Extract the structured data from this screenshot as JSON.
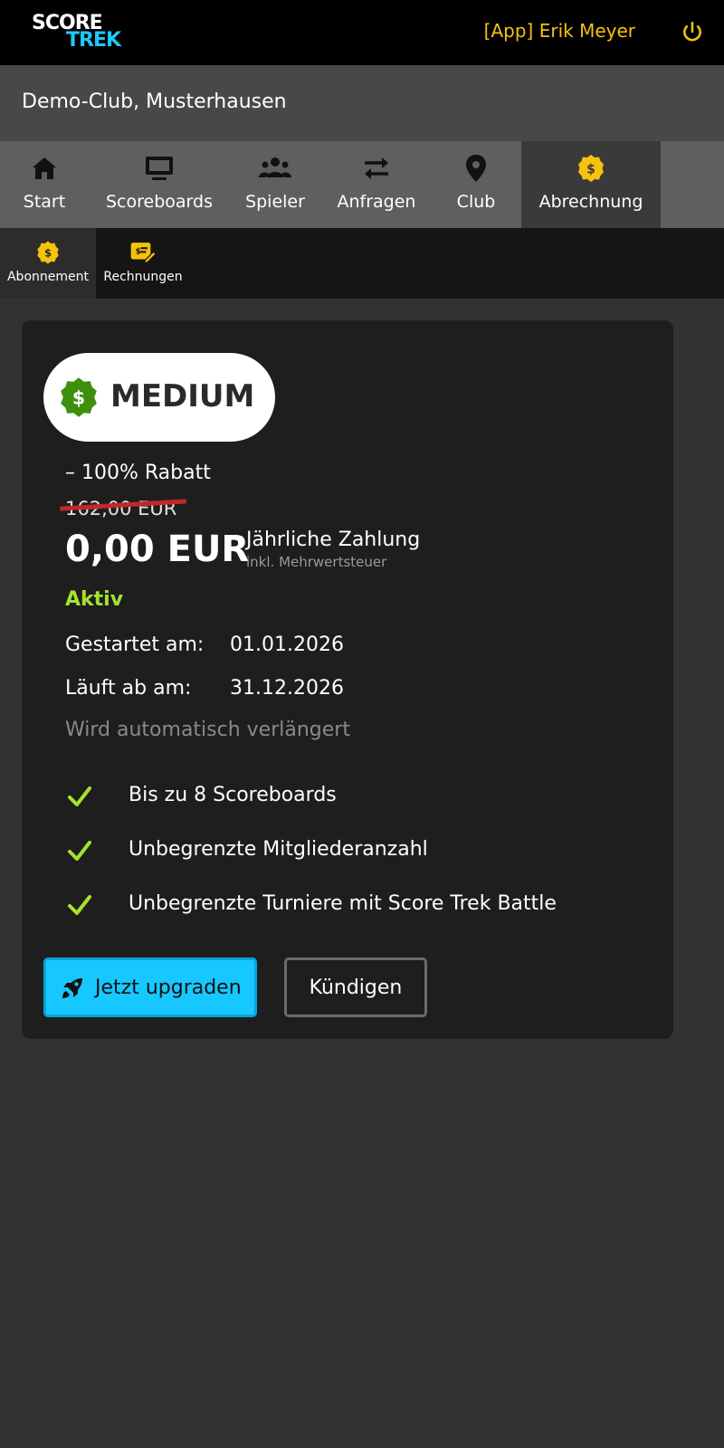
{
  "header": {
    "logo_line1": "SCORE",
    "logo_line2": "TREK",
    "user_label": "[App] Erik Meyer"
  },
  "club": {
    "name": "Demo-Club, Musterhausen"
  },
  "main_nav": [
    {
      "label": "Start",
      "icon": "home-icon"
    },
    {
      "label": "Scoreboards",
      "icon": "monitor-icon"
    },
    {
      "label": "Spieler",
      "icon": "users-icon"
    },
    {
      "label": "Anfragen",
      "icon": "exchange-arrows-icon"
    },
    {
      "label": "Club",
      "icon": "location-pin-icon"
    },
    {
      "label": "Abrechnung",
      "icon": "dollar-badge-icon",
      "active": true
    }
  ],
  "sub_nav": [
    {
      "label": "Abonnement",
      "icon": "dollar-badge-icon",
      "active": true
    },
    {
      "label": "Rechnungen",
      "icon": "invoice-edit-icon"
    }
  ],
  "subscription": {
    "plan_name": "MEDIUM",
    "discount": "– 100% Rabatt",
    "old_price": "162,00 EUR",
    "price": "0,00 EUR",
    "billing_period": "Jährliche Zahlung",
    "vat_note": "inkl. Mehrwertsteuer",
    "status": "Aktiv",
    "started_label": "Gestartet am:",
    "started_value": "01.01.2026",
    "expires_label": "Läuft ab am:",
    "expires_value": "31.12.2026",
    "renewal_note": "Wird automatisch verlängert",
    "features": [
      "Bis zu 8 Scoreboards",
      "Unbegrenzte Mitgliederanzahl",
      "Unbegrenzte Turniere mit Score Trek Battle"
    ],
    "upgrade_label": "Jetzt upgraden",
    "cancel_label": "Kündigen"
  },
  "colors": {
    "accent_yellow": "#f5c20c",
    "accent_cyan": "#16c8ff",
    "status_green": "#a6e22e",
    "plan_green": "#3f8f0e",
    "strike_red": "#c0282d"
  }
}
